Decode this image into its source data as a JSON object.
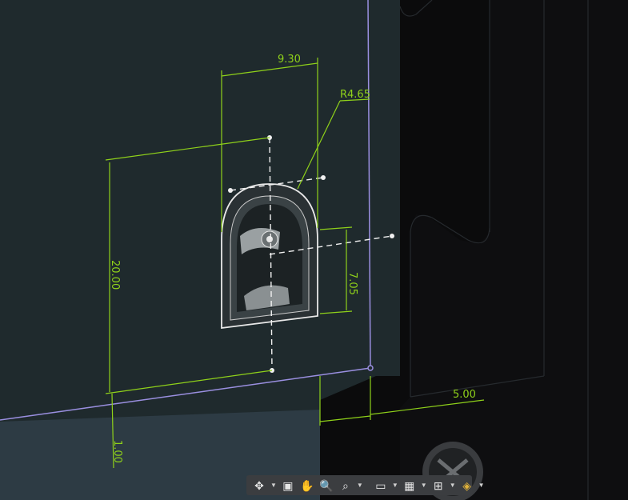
{
  "dimensions": {
    "width_top": "9.30",
    "radius": "R4.65",
    "height_left": "20.00",
    "height_right": "7.05",
    "offset_bottom": "1.00",
    "offset_right": "5.00"
  },
  "toolbar": {
    "items": [
      {
        "name": "orbit-icon",
        "glyph": "✥"
      },
      {
        "name": "look-at-icon",
        "glyph": "▣"
      },
      {
        "name": "pan-icon",
        "glyph": "✋"
      },
      {
        "name": "zoom-icon",
        "glyph": "🔍"
      },
      {
        "name": "fit-icon",
        "glyph": "⌕"
      },
      {
        "name": "display-settings-icon",
        "glyph": "▭"
      },
      {
        "name": "grid-settings-icon",
        "glyph": "▦"
      },
      {
        "name": "viewports-icon",
        "glyph": "⊞"
      },
      {
        "name": "environment-icon",
        "glyph": "◈"
      }
    ]
  },
  "colors": {
    "dimension": "#8fd11a",
    "sketch_line": "#9a8fe0",
    "background": "#1f2a2d",
    "body_dark": "#0b0b0c",
    "toolbar_bg": "#3b3d40"
  }
}
